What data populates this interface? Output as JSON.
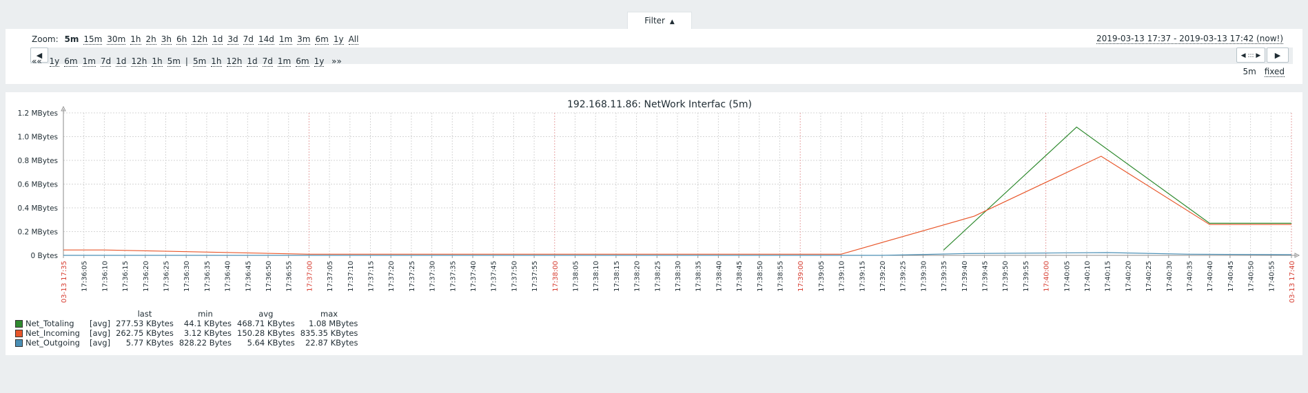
{
  "filter": {
    "label": "Filter",
    "arrow": "▲"
  },
  "zoom": {
    "label": "Zoom:",
    "options": [
      "5m",
      "15m",
      "30m",
      "1h",
      "2h",
      "3h",
      "6h",
      "12h",
      "1d",
      "3d",
      "7d",
      "14d",
      "1m",
      "3m",
      "6m",
      "1y",
      "All"
    ],
    "selected": "5m"
  },
  "period": {
    "text": "2019-03-13 17:37 - 2019-03-13 17:42 (now!)"
  },
  "nav": {
    "prev_icon": "triangle-left-icon",
    "next_icon": "triangle-right-icon",
    "back_links": [
      "«« ",
      "1y",
      "6m",
      "1m",
      "7d",
      "1d",
      "12h",
      "1h",
      "5m"
    ],
    "separator": "|",
    "fwd_links": [
      "5m",
      "1h",
      "12h",
      "1d",
      "7d",
      "1m",
      "6m",
      "1y",
      " »»"
    ],
    "period_label": "5m",
    "fixed_label": "fixed"
  },
  "chart_data": {
    "type": "line",
    "title": "192.168.11.86: NetWork Interfac (5m)",
    "ylabel": "",
    "y_ticks": [
      "0 Bytes",
      "0.2 MBytes",
      "0.4 MBytes",
      "0.6 MBytes",
      "0.8 MBytes",
      "1.0 MBytes",
      "1.2 MBytes"
    ],
    "ylim": [
      0,
      1.2
    ],
    "x_ticks": [
      "03-13 17:35",
      "17:36:05",
      "17:36:10",
      "17:36:15",
      "17:36:20",
      "17:36:25",
      "17:36:30",
      "17:36:35",
      "17:36:40",
      "17:36:45",
      "17:36:50",
      "17:36:55",
      "17:37:00",
      "17:37:05",
      "17:37:10",
      "17:37:15",
      "17:37:20",
      "17:37:25",
      "17:37:30",
      "17:37:35",
      "17:37:40",
      "17:37:45",
      "17:37:50",
      "17:37:55",
      "17:38:00",
      "17:38:05",
      "17:38:10",
      "17:38:15",
      "17:38:20",
      "17:38:25",
      "17:38:30",
      "17:38:35",
      "17:38:40",
      "17:38:45",
      "17:38:50",
      "17:38:55",
      "17:39:00",
      "17:39:05",
      "17:39:10",
      "17:39:15",
      "17:39:20",
      "17:39:25",
      "17:39:30",
      "17:39:35",
      "17:39:40",
      "17:39:45",
      "17:39:50",
      "17:39:55",
      "17:40:00",
      "17:40:05",
      "17:40:10",
      "17:40:15",
      "17:40:20",
      "17:40:25",
      "17:40:30",
      "17:40:35",
      "17:40:40",
      "17:40:45",
      "17:40:50",
      "17:40:55",
      "03-13 17:40"
    ],
    "major_ticks": [
      "03-13 17:35",
      "17:37:00",
      "17:38:00",
      "17:39:00",
      "17:40:00",
      "03-13 17:40"
    ],
    "grid": true,
    "series": [
      {
        "name": "Net_Totaling",
        "color": "#2f8a2f",
        "points": [
          [
            43,
            0.044
          ],
          [
            49.5,
            1.08
          ],
          [
            56,
            0.27
          ],
          [
            60,
            0.27
          ]
        ]
      },
      {
        "name": "Net_Incoming",
        "color": "#e8562a",
        "points": [
          [
            0,
            0.045
          ],
          [
            2,
            0.045
          ],
          [
            12,
            0.01
          ],
          [
            38,
            0.01
          ],
          [
            44.5,
            0.33
          ],
          [
            50.7,
            0.835
          ],
          [
            56,
            0.26
          ],
          [
            60,
            0.26
          ]
        ]
      },
      {
        "name": "Net_Outgoing",
        "color": "#4a8fb5",
        "points": [
          [
            0,
            0.0
          ],
          [
            40,
            0.0
          ],
          [
            44,
            0.015
          ],
          [
            48,
            0.02
          ],
          [
            51,
            0.023
          ],
          [
            55,
            0.01
          ],
          [
            60,
            0.006
          ]
        ]
      }
    ]
  },
  "legend": {
    "headers": [
      "last",
      "min",
      "avg",
      "max"
    ],
    "rows": [
      {
        "name": "Net_Totaling",
        "func": "[avg]",
        "last": "277.53 KBytes",
        "min": "44.1 KBytes",
        "avg": "468.71 KBytes",
        "max": "1.08 MBytes",
        "color": "#2f8a2f"
      },
      {
        "name": "Net_Incoming",
        "func": "[avg]",
        "last": "262.75 KBytes",
        "min": "3.12 KBytes",
        "avg": "150.28 KBytes",
        "max": "835.35 KBytes",
        "color": "#e8562a"
      },
      {
        "name": "Net_Outgoing",
        "func": "[avg]",
        "last": "5.77 KBytes",
        "min": "828.22 Bytes",
        "avg": "5.64 KBytes",
        "max": "22.87 KBytes",
        "color": "#4a8fb5"
      }
    ]
  }
}
